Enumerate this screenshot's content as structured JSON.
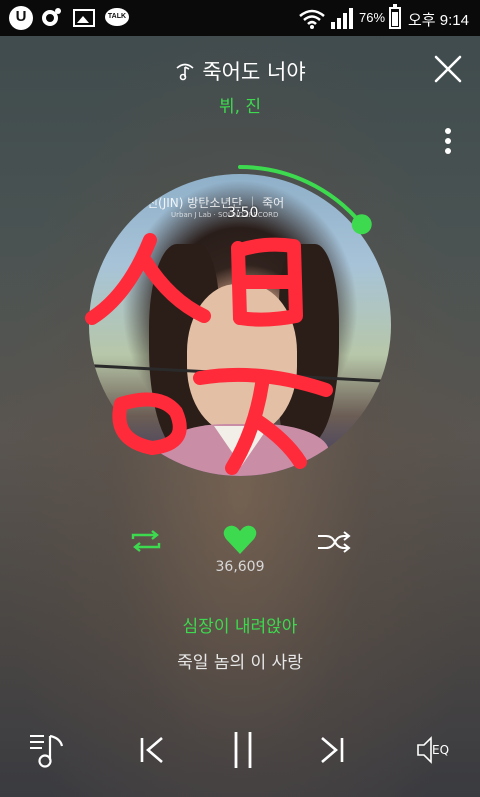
{
  "status_bar": {
    "app_icon_label": "U",
    "talk_label": "TALK",
    "battery_percent": "76%",
    "battery_level": 0.76,
    "time": "오후 9:14"
  },
  "player": {
    "title": "죽어도 너야",
    "artist": "뷔, 진",
    "elapsed": "3:50",
    "progress_fraction": 0.14,
    "art_caption": "진(JIN) 방탄소년단 ｜ 죽어",
    "art_caption_small": "Urban J Lab · SOUNDZRECORD",
    "like_count": "36,609",
    "lyric_current": "심장이 내려앉아",
    "lyric_next": "죽일 놈의 이 사랑",
    "eq_label": "EQ"
  },
  "colors": {
    "accent": "#3dd94f",
    "scribble": "#ff2b3a"
  },
  "icons": {
    "close": "close-icon",
    "more": "more-vertical-icon",
    "repeat": "repeat-icon",
    "like": "heart-icon",
    "shuffle": "shuffle-icon",
    "playlist": "playlist-icon",
    "prev": "previous-icon",
    "pause": "pause-icon",
    "next": "next-icon",
    "eq": "equalizer-icon"
  }
}
